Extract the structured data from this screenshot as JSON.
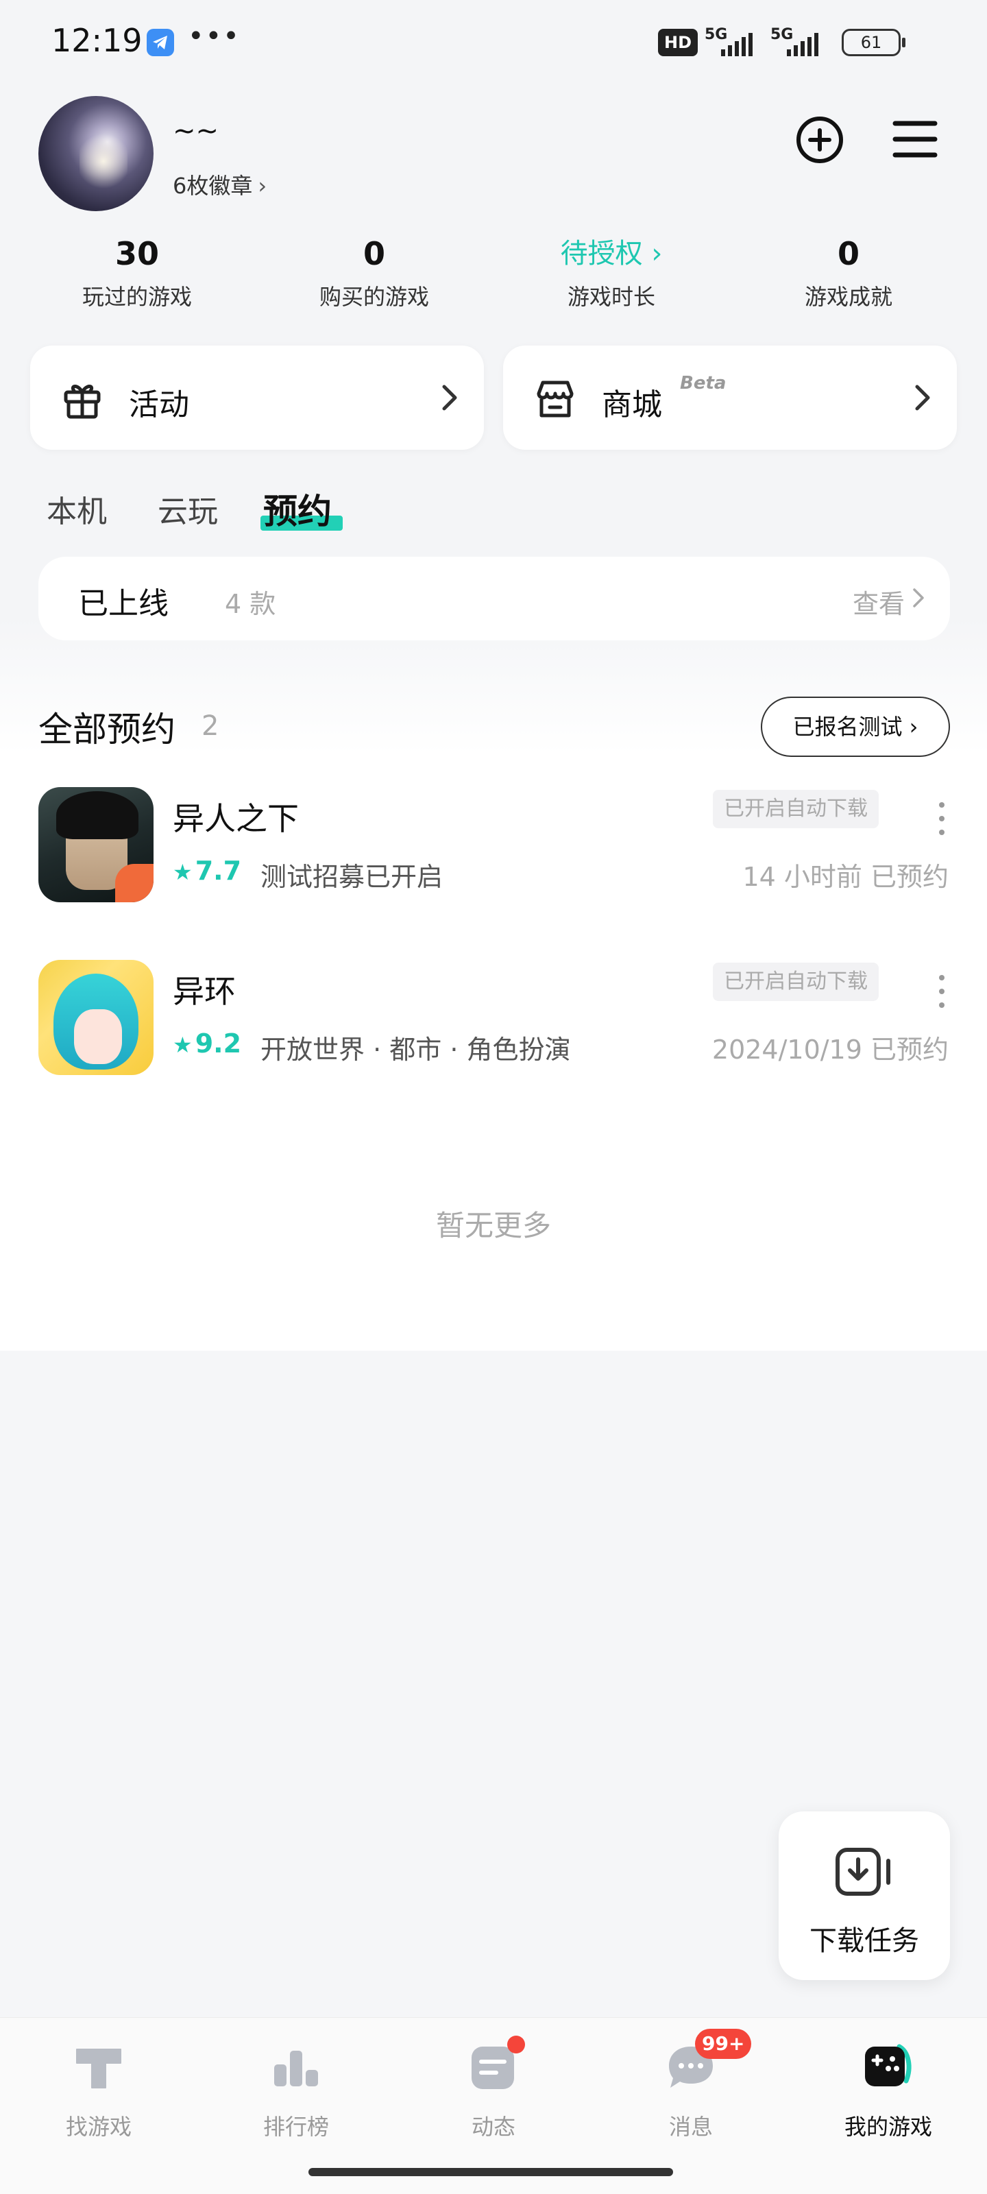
{
  "status_bar": {
    "time": "12:19",
    "dots": "•••",
    "hd_label": "HD",
    "signal1_label": "5G",
    "signal2_label": "5G",
    "battery": "61"
  },
  "profile": {
    "name": "~~",
    "badges_label": "6枚徽章",
    "badges_chevron": "›"
  },
  "stats": [
    {
      "value": "30",
      "label": "玩过的游戏"
    },
    {
      "value": "0",
      "label": "购买的游戏"
    },
    {
      "value": "待授权 ›",
      "label": "游戏时长"
    },
    {
      "value": "0",
      "label": "游戏成就"
    }
  ],
  "cards": {
    "activity": "活动",
    "store": "商城",
    "store_beta": "Beta"
  },
  "tabs": [
    "本机",
    "云玩",
    "预约"
  ],
  "online": {
    "title": "已上线",
    "count": "4 款",
    "view": "查看"
  },
  "section": {
    "title": "全部预约",
    "count": "2",
    "test_button": "已报名测试 ›"
  },
  "games": [
    {
      "name": "异人之下",
      "rating": "7.7",
      "desc": "测试招募已开启",
      "tag": "已开启自动下载",
      "time": "14 小时前 已预约"
    },
    {
      "name": "异环",
      "rating": "9.2",
      "desc": "开放世界 · 都市 · 角色扮演",
      "tag": "已开启自动下载",
      "time": "2024/10/19 已预约"
    }
  ],
  "no_more": "暂无更多",
  "download_task": "下载任务",
  "bottom_nav": [
    {
      "label": "找游戏",
      "icon": "find-game-icon"
    },
    {
      "label": "排行榜",
      "icon": "ranking-icon"
    },
    {
      "label": "动态",
      "icon": "feed-icon"
    },
    {
      "label": "消息",
      "icon": "message-icon",
      "badge": "99+"
    },
    {
      "label": "我的游戏",
      "icon": "my-games-icon"
    }
  ],
  "colors": {
    "accent": "#1ec7b0",
    "tab_underline": "#22d0b6",
    "badge_red": "#f4453a",
    "background": "#f5f6f8"
  }
}
